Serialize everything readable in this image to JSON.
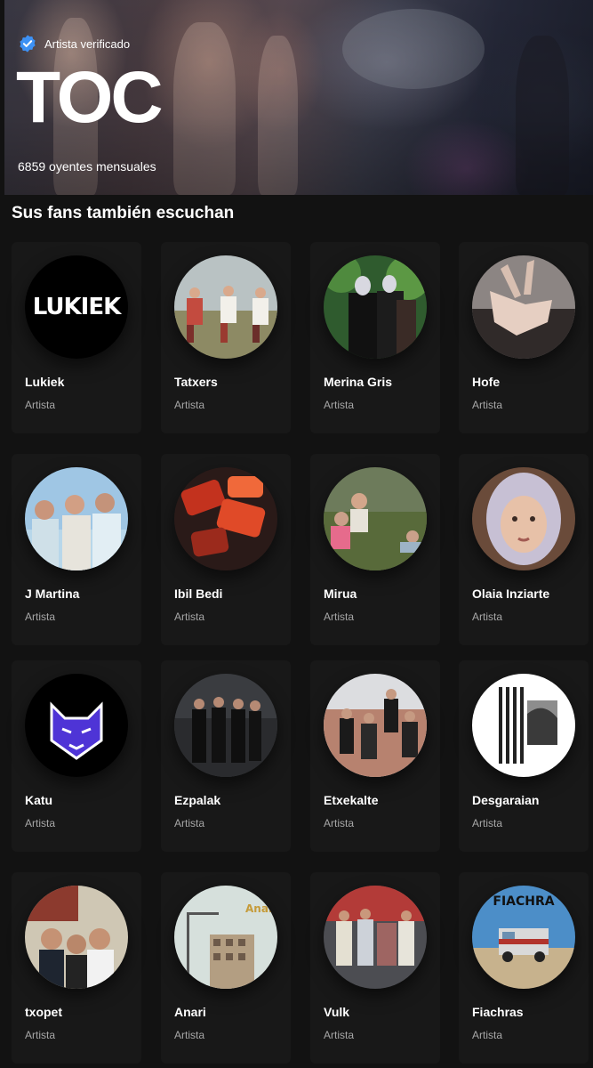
{
  "hero": {
    "verified_label": "Artista verificado",
    "artist_name": "TOC",
    "monthly_listeners": "6859 oyentes mensuales",
    "verified_color": "#3d91f4"
  },
  "section": {
    "title": "Sus fans también escuchan"
  },
  "artists": [
    {
      "name": "Lukiek",
      "type": "Artista",
      "image": "black-logo"
    },
    {
      "name": "Tatxers",
      "type": "Artista",
      "image": "three-men-field"
    },
    {
      "name": "Merina Gris",
      "type": "Artista",
      "image": "masked-duo-plants"
    },
    {
      "name": "Hofe",
      "type": "Artista",
      "image": "hands-bodies"
    },
    {
      "name": "J Martina",
      "type": "Artista",
      "image": "three-people-sky"
    },
    {
      "name": "Ibil Bedi",
      "type": "Artista",
      "image": "red-abstract"
    },
    {
      "name": "Mirua",
      "type": "Artista",
      "image": "group-grass"
    },
    {
      "name": "Olaia Inziarte",
      "type": "Artista",
      "image": "woman-headscarf"
    },
    {
      "name": "Katu",
      "type": "Artista",
      "image": "purple-cat-logo"
    },
    {
      "name": "Ezpalak",
      "type": "Artista",
      "image": "group-dark-street"
    },
    {
      "name": "Etxekalte",
      "type": "Artista",
      "image": "group-brick-wall"
    },
    {
      "name": "Desgaraian",
      "type": "Artista",
      "image": "bw-stripes"
    },
    {
      "name": "txopet",
      "type": "Artista",
      "image": "group-selfie"
    },
    {
      "name": "Anari",
      "type": "Artista",
      "image": "building-cranes"
    },
    {
      "name": "Vulk",
      "type": "Artista",
      "image": "group-blurred"
    },
    {
      "name": "Fiachras",
      "type": "Artista",
      "image": "truck-desert"
    }
  ]
}
